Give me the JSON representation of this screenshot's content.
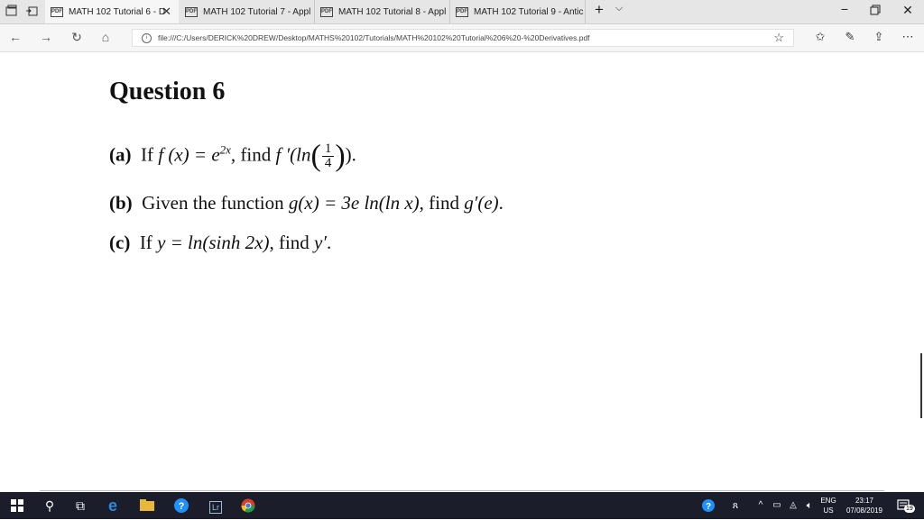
{
  "tabs": [
    {
      "label": "MATH 102 Tutorial 6 - D",
      "active": true
    },
    {
      "label": "MATH 102 Tutorial 7 - Appl",
      "active": false
    },
    {
      "label": "MATH 102 Tutorial 8 - Appl",
      "active": false
    },
    {
      "label": "MATH 102 Tutorial 9 - Antic",
      "active": false
    }
  ],
  "pdf_badge": "PDF",
  "address": {
    "url": "file:///C:/Users/DERICK%20DREW/Desktop/MATHS%20102/Tutorials/MATH%20102%20Tutorial%206%20-%20Derivatives.pdf"
  },
  "document": {
    "title": "Question 6",
    "parts": {
      "a_label": "(a)",
      "a_text_1": "If",
      "a_math_1": "f (x) = e",
      "a_sup": "2x",
      "a_text_2": ", find",
      "a_math_2": "f ′(ln",
      "a_num": "1",
      "a_den": "4",
      "a_end": ").",
      "b_label": "(b)",
      "b_text": "Given the function",
      "b_math": "g(x) = 3e ln(ln x)",
      "b_text_2": ", find",
      "b_math_2": "g′(e)",
      "b_end": ".",
      "c_label": "(c)",
      "c_text": "If",
      "c_math": "y = ln(sinh 2x)",
      "c_text_2": ", find",
      "c_math_2": "y′",
      "c_end": "."
    }
  },
  "taskbar": {
    "lang_1": "ENG",
    "lang_2": "US",
    "time": "23:17",
    "date": "07/08/2019",
    "notif_count": "19",
    "lr_label": "Lr"
  }
}
